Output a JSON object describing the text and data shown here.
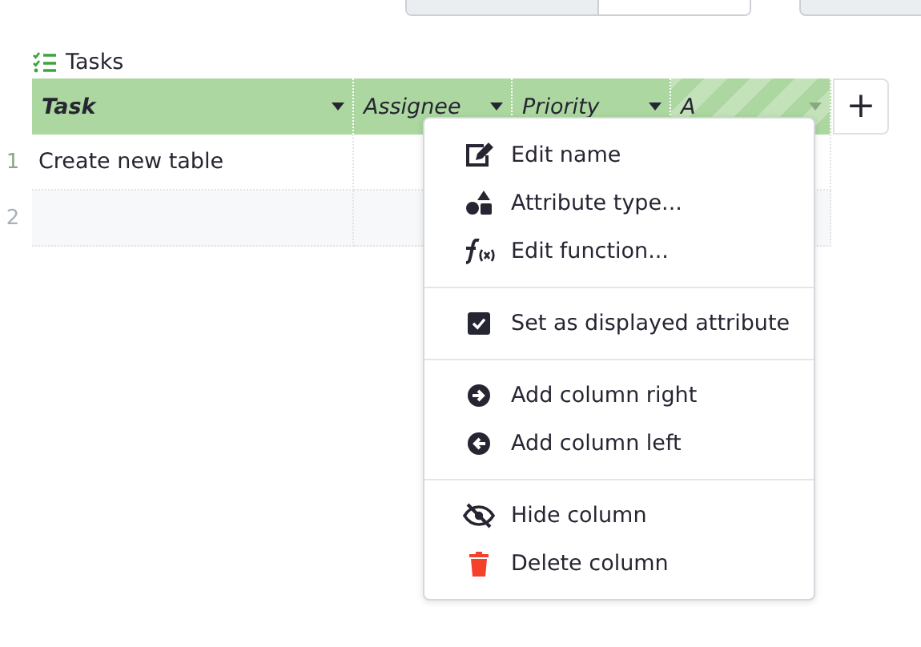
{
  "table": {
    "title": "Tasks",
    "columns": [
      {
        "label": "Task",
        "displayed": true,
        "selected": false
      },
      {
        "label": "Assignee",
        "displayed": false,
        "selected": false
      },
      {
        "label": "Priority",
        "displayed": false,
        "selected": false
      },
      {
        "label": "A",
        "displayed": false,
        "selected": true
      }
    ],
    "add_column": "+",
    "rows": [
      {
        "number": "1",
        "kind": "record",
        "cells": [
          "Create new table"
        ]
      },
      {
        "number": "2",
        "kind": "add"
      }
    ]
  },
  "column_menu": {
    "groups": [
      [
        {
          "label": "Edit name",
          "kind": "edit"
        },
        {
          "label": "Attribute type...",
          "kind": "shapes"
        },
        {
          "label": "Edit function...",
          "kind": "function"
        }
      ],
      [
        {
          "label": "Set as displayed attribute",
          "kind": "check",
          "checked": true
        }
      ],
      [
        {
          "label": "Add column right",
          "kind": "right"
        },
        {
          "label": "Add column left",
          "kind": "left"
        }
      ],
      [
        {
          "label": "Hide column",
          "kind": "hide"
        },
        {
          "label": "Delete column",
          "kind": "delete"
        }
      ]
    ]
  }
}
